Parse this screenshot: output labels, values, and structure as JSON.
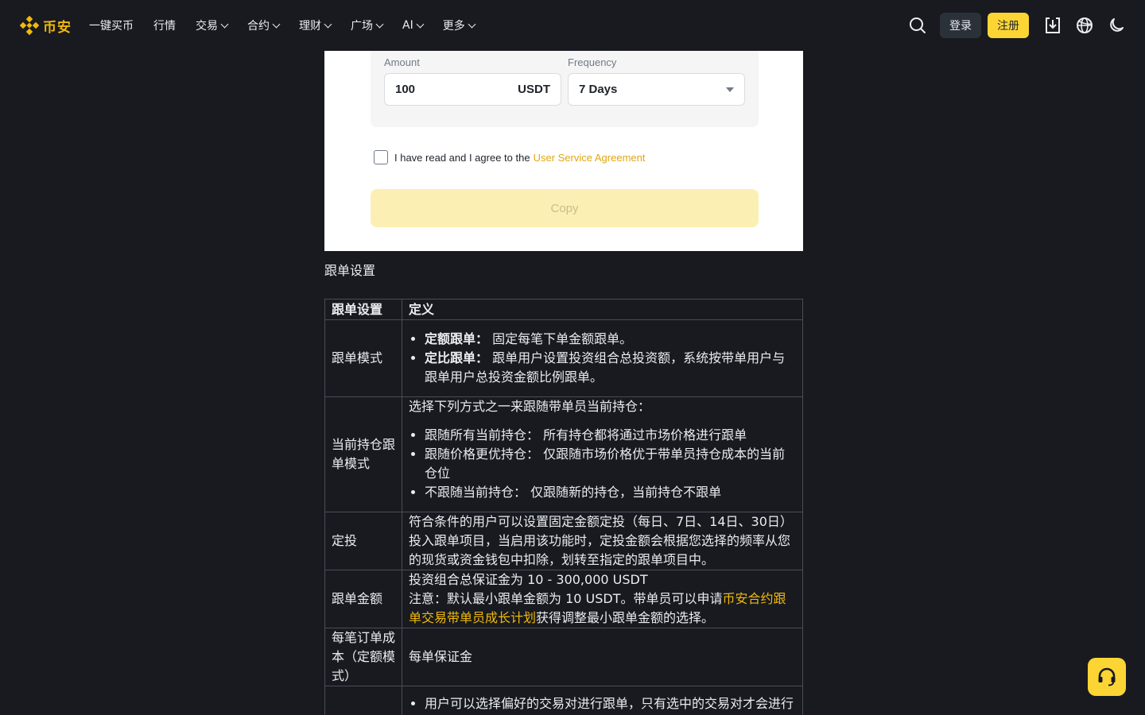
{
  "header": {
    "logo_text": "币安",
    "nav": [
      {
        "label": "一键买币",
        "dropdown": false
      },
      {
        "label": "行情",
        "dropdown": false
      },
      {
        "label": "交易",
        "dropdown": true
      },
      {
        "label": "合约",
        "dropdown": true
      },
      {
        "label": "理财",
        "dropdown": true
      },
      {
        "label": "广场",
        "dropdown": true
      },
      {
        "label": "AI",
        "dropdown": true
      },
      {
        "label": "更多",
        "dropdown": true
      }
    ],
    "login_label": "登录",
    "register_label": "注册",
    "icons": [
      "search-icon",
      "download-icon",
      "globe-icon",
      "moon-icon"
    ]
  },
  "screenshot": {
    "amount_label": "Amount",
    "amount_value": "100",
    "amount_unit": "USDT",
    "frequency_label": "Frequency",
    "frequency_value": "7 Days",
    "agree_text": "I have read and I agree to the",
    "agree_link": "User Service Agreement",
    "copy_label": "Copy"
  },
  "caption": "跟单设置",
  "table": {
    "headers": [
      "跟单设置",
      "定义"
    ],
    "row1": {
      "name": "跟单模式",
      "item1_bold": "定额跟单：",
      "item1_text": " 固定每笔下单金额跟单。",
      "item2_bold": "定比跟单：",
      "item2_text": " 跟单用户设置投资组合总投资额，系统按带单用户与跟单用户总投资金额比例跟单。"
    },
    "row2": {
      "name": "当前持仓跟单模式",
      "intro": "选择下列方式之一来跟随带单员当前持仓：",
      "items": [
        "跟随所有当前持仓： 所有持仓都将通过市场价格进行跟单",
        "跟随价格更优持仓： 仅跟随市场价格优于带单员持仓成本的当前仓位",
        "不跟随当前持仓： 仅跟随新的持仓，当前持仓不跟单"
      ]
    },
    "row3": {
      "name": "定投",
      "text": "符合条件的用户可以设置固定金额定投（每日、7日、14日、30日）投入跟单项目，当启用该功能时，定投金额会根据您选择的频率从您的现货或资金钱包中扣除，划转至指定的跟单项目中。"
    },
    "row4": {
      "name": "跟单金额",
      "line1": "投资组合总保证金为 10 - 300,000 USDT",
      "note_prefix": "注意：默认最小跟单金额为 10 USDT。带单员可以申请",
      "note_link": "币安合约跟单交易带单员成长计划",
      "note_suffix": "获得调整最小跟单金额的选择。"
    },
    "row5": {
      "name": "每笔订单成本（定额模式）",
      "text": "每单保证金"
    },
    "row6": {
      "name": "",
      "item1": "用户可以选择偏好的交易对进行跟单，只有选中的交易对才会进行"
    }
  },
  "colors": {
    "background": "#181a20",
    "accent": "#f0b90b",
    "register_button": "#fcd535",
    "border": "#474d57"
  },
  "support_icon": "headset-icon"
}
